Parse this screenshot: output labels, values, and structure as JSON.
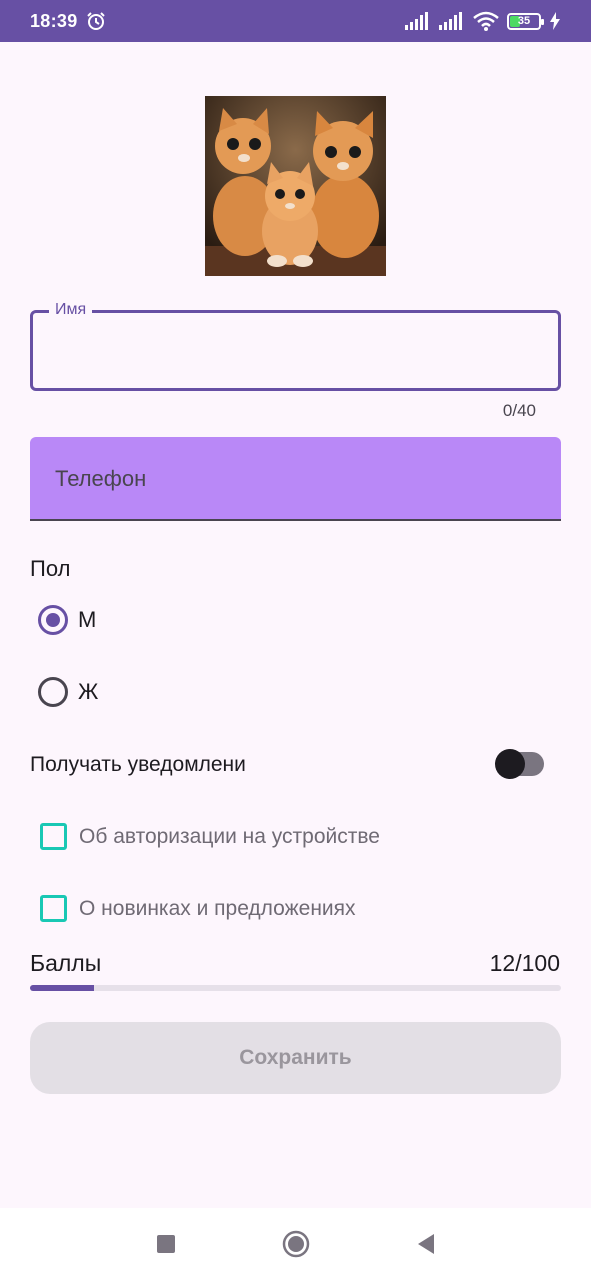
{
  "status_bar": {
    "time": "18:39",
    "battery_level": "35",
    "icons": [
      "alarm-icon",
      "signal-icon",
      "signal-icon",
      "wifi-icon",
      "battery-icon",
      "charging-icon"
    ]
  },
  "form": {
    "name_field": {
      "label": "Имя",
      "value": "",
      "counter": "0/40"
    },
    "phone_field": {
      "placeholder": "Телефон",
      "value": ""
    },
    "gender": {
      "label": "Пол",
      "options": [
        {
          "label": "М",
          "checked": true
        },
        {
          "label": "Ж",
          "checked": false
        }
      ]
    },
    "notifications": {
      "label": "Получать уведомлени",
      "enabled": false,
      "options": [
        {
          "label": "Об авторизации на устройстве",
          "checked": false
        },
        {
          "label": "О новинках и предложениях",
          "checked": false
        }
      ]
    },
    "score": {
      "label": "Баллы",
      "value_text": "12/100",
      "value": 12,
      "max": 100
    },
    "save_label": "Сохранить"
  },
  "colors": {
    "primary": "#6750a4",
    "filled_field": "#b988f7",
    "checkbox_accent": "#19c8b4",
    "background": "#fdf6fd"
  },
  "nav": {
    "icons": [
      "recent-apps-icon",
      "home-icon",
      "back-icon"
    ]
  }
}
